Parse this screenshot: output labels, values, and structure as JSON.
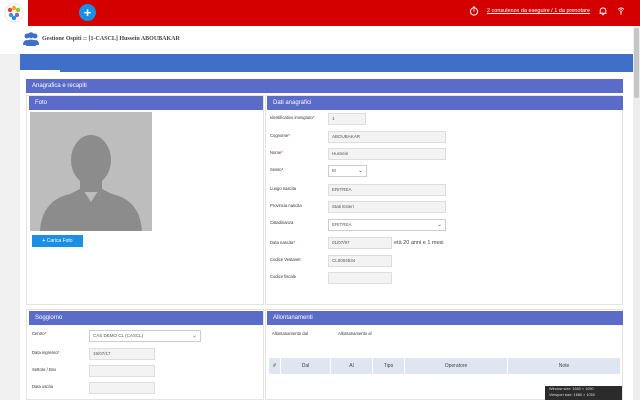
{
  "topbar": {
    "consultations_link": "2 consulenze da eseguire / 1 da prenotare"
  },
  "header": {
    "title": "Gestione Ospiti :: [1-CASCL] Hussein ABOUBAKAR"
  },
  "section_anagrafica": "Anagrafica e recapiti",
  "foto": {
    "title": "Foto",
    "upload_label": "Carica Foto"
  },
  "dati": {
    "title": "Dati anagrafici",
    "fields": [
      {
        "label": "Identificativo immigrato",
        "required": true,
        "value": "1"
      },
      {
        "label": "Cognome",
        "required": true,
        "value": "ABOUBAKAR"
      },
      {
        "label": "Nome",
        "required": true,
        "value": "Hussein"
      },
      {
        "label": "Sesso",
        "required": true,
        "value": "M"
      },
      {
        "label": "Luogo nascita",
        "required": false,
        "value": "ERITREA"
      },
      {
        "label": "Provincia nascita",
        "required": false,
        "value": "Stati Esteri"
      },
      {
        "label": "Cittadinanza",
        "required": false,
        "value": "ERITREA"
      },
      {
        "label": "Data nascita",
        "required": true,
        "value": "01/07/97"
      },
      {
        "label": "Codice Vestanet",
        "required": false,
        "value": "CL0004534"
      },
      {
        "label": "Codice fiscale",
        "required": false,
        "value": ""
      }
    ],
    "age_text": "età 20 anni e 1 mesi"
  },
  "soggiorno": {
    "title": "Soggiorno",
    "fields": [
      {
        "label": "Centro",
        "required": true,
        "value": "CAS DEMO CL (CASCL)"
      },
      {
        "label": "Data ingresso",
        "required": true,
        "value": "19/07/17"
      },
      {
        "label": "Settore / Box",
        "required": false,
        "value": ""
      },
      {
        "label": "Data uscita",
        "required": false,
        "value": ""
      }
    ]
  },
  "allontanamenti": {
    "title": "Allontanamenti",
    "link": "",
    "from_label": "Allontanamento dal",
    "to_label": "Allontanamento al",
    "columns": [
      "#",
      "Dal",
      "Al",
      "Tipo",
      "Operatore",
      "Note"
    ]
  },
  "viewport_info": {
    "window": "Window size: 1680 × 1050",
    "viewport": "Viewport size: 1680 × 1050"
  },
  "colors": {
    "topbar": "#d40000",
    "accent_blue": "#1a8fe3",
    "section_bar": "#5b6bc8",
    "title_bar": "#3f6fc6"
  }
}
